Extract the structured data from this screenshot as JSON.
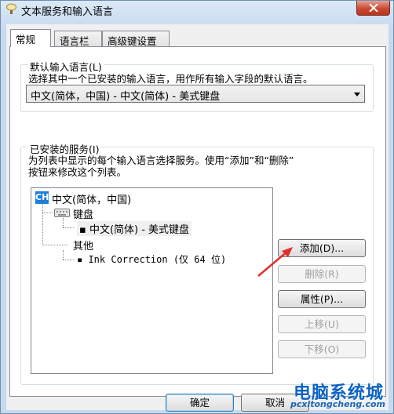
{
  "window": {
    "title": "文本服务和输入语言"
  },
  "tabs": [
    {
      "label": "常规",
      "active": true
    },
    {
      "label": "语言栏",
      "active": false
    },
    {
      "label": "高级键设置",
      "active": false
    }
  ],
  "default_language": {
    "group_label": "默认输入语言(L)",
    "description": "选择其中一个已安装的输入语言，用作所有输入字段的默认语言。",
    "selected": "中文(简体，中国) - 中文(简体) - 美式键盘"
  },
  "installed_services": {
    "group_label": "已安装的服务(I)",
    "description_line1": "为列表中显示的每个输入语言选择服务。使用“添加”和“删除”",
    "description_line2": "按钮来修改这个列表。",
    "tree": {
      "language": "中文(简体，中国)",
      "language_icon_text": "CH",
      "keyboard_label": "键盘",
      "keyboard_item": "中文(简体) - 美式键盘",
      "other_label": "其他",
      "other_item": "Ink Correction (仅 64 位)"
    },
    "buttons": {
      "add": "添加(D)...",
      "remove": "删除(R)",
      "properties": "属性(P)...",
      "move_up": "上移(U)",
      "move_down": "下移(O)"
    }
  },
  "footer": {
    "ok": "确定",
    "cancel": "取消"
  },
  "watermark": {
    "main": "电脑系统城",
    "sub": "pcxitongcheng.com"
  },
  "colors": {
    "accent": "#1e7fd8",
    "close": "#c84a34",
    "arrow": "#e0302a"
  }
}
